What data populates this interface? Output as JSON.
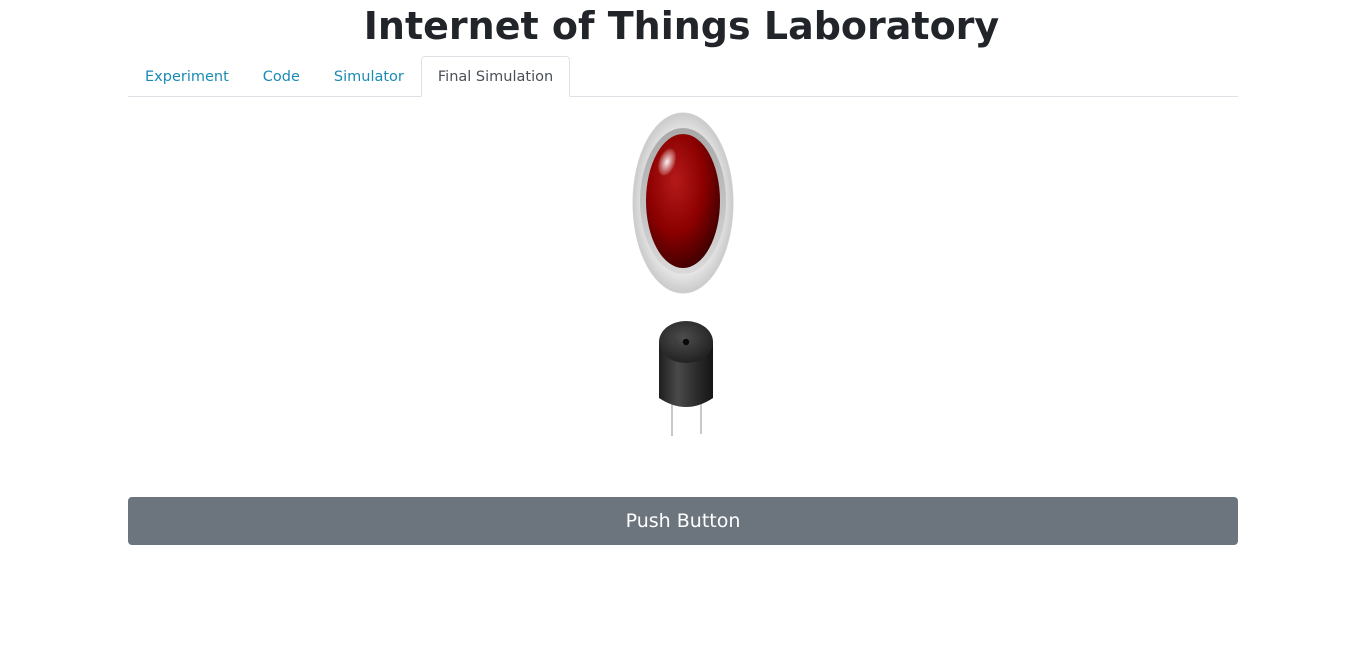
{
  "header": {
    "title": "Internet of Things Laboratory"
  },
  "tabs": [
    {
      "label": "Experiment",
      "active": false
    },
    {
      "label": "Code",
      "active": false
    },
    {
      "label": "Simulator",
      "active": false
    },
    {
      "label": "Final Simulation",
      "active": true
    }
  ],
  "simulation": {
    "led": {
      "icon": "red-led-icon",
      "color": "#8b0000",
      "state": "on"
    },
    "buzzer": {
      "icon": "buzzer-icon",
      "color": "#2b2b2b"
    },
    "button_label": "Push Button"
  },
  "colors": {
    "tab_link": "#1a8ab5",
    "tab_active": "#495057",
    "button_bg": "#6c757d",
    "button_text": "#ffffff"
  }
}
